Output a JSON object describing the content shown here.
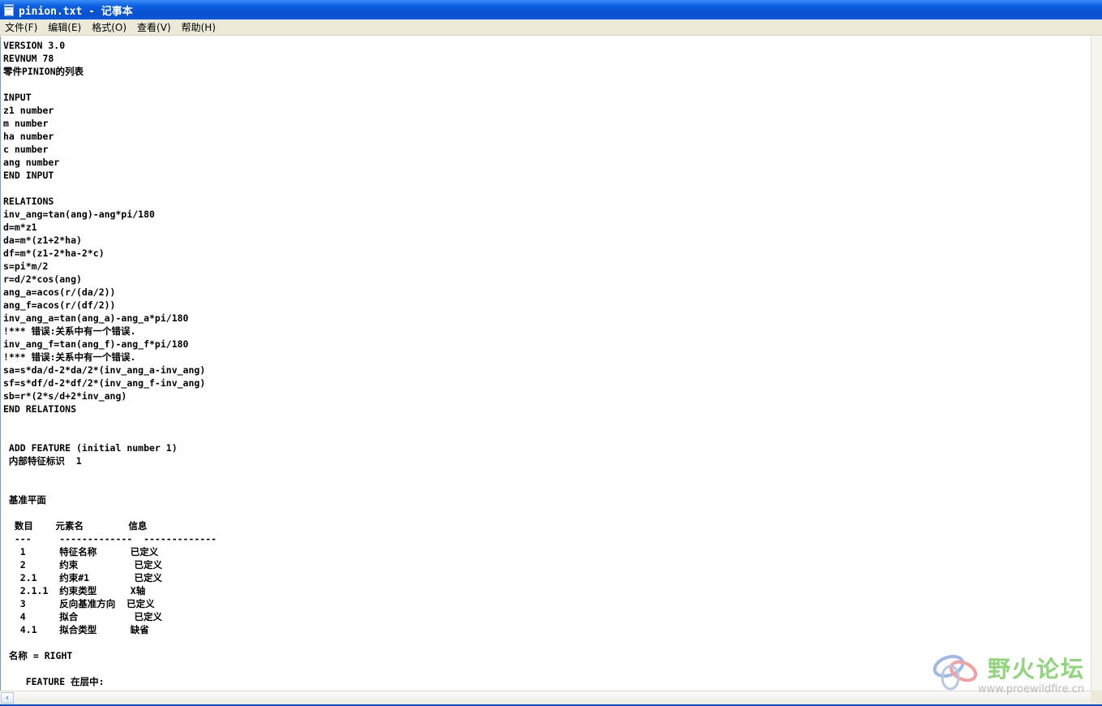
{
  "window": {
    "title": "pinion.txt - 记事本"
  },
  "menu": {
    "items": [
      "文件(F)",
      "编辑(E)",
      "格式(O)",
      "查看(V)",
      "帮助(H)"
    ]
  },
  "editor": {
    "lines": [
      "VERSION 3.0",
      "REVNUM 78",
      "零件PINION的列表",
      "",
      "INPUT",
      "z1 number",
      "m number",
      "ha number",
      "c number",
      "ang number",
      "END INPUT",
      "",
      "RELATIONS",
      "inv_ang=tan(ang)-ang*pi/180",
      "d=m*z1",
      "da=m*(z1+2*ha)",
      "df=m*(z1-2*ha-2*c)",
      "s=pi*m/2",
      "r=d/2*cos(ang)",
      "ang_a=acos(r/(da/2))",
      "ang_f=acos(r/(df/2))",
      "inv_ang_a=tan(ang_a)-ang_a*pi/180",
      "!*** 错误:关系中有一个错误.",
      "inv_ang_f=tan(ang_f)-ang_f*pi/180",
      "!*** 错误:关系中有一个错误.",
      "sa=s*da/d-2*da/2*(inv_ang_a-inv_ang)",
      "sf=s*df/d-2*df/2*(inv_ang_f-inv_ang)",
      "sb=r*(2*s/d+2*inv_ang)",
      "END RELATIONS",
      "",
      "",
      " ADD FEATURE (initial number 1)",
      " 内部特征标识  1",
      "",
      "",
      " 基准平面",
      "",
      "  数目    元素名        信息",
      "  ---     -------------  -------------",
      "   1      特征名称      已定义",
      "   2      约束          已定义",
      "   2.1    约束#1        已定义",
      "   2.1.1  约束类型      X轴",
      "   3      反向基准方向  已定义",
      "   4      拟合          已定义",
      "   4.1    拟合类型      缺省",
      "",
      " 名称 = RIGHT",
      "",
      "    FEATURE 在层中:"
    ]
  },
  "watermark": {
    "title": "野火论坛",
    "url": "www.proewildfire.cn"
  },
  "icons": {
    "app": "notepad-icon",
    "scroll_left": "scroll-left-arrow-icon"
  }
}
